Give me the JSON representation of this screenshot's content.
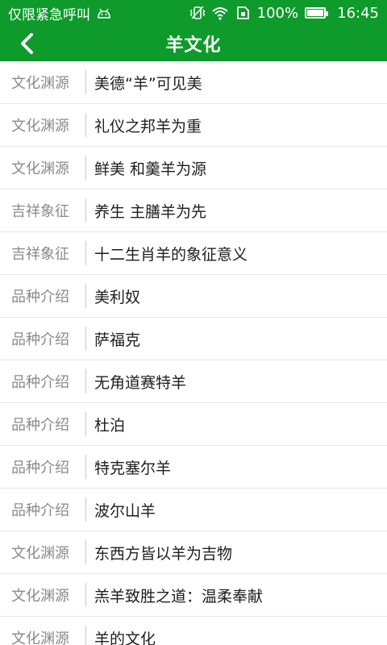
{
  "status_bar": {
    "carrier": "仅限紧急呼叫",
    "battery_percent": "100%",
    "time": "16:45",
    "icons": [
      "android-icon",
      "vibrate-icon",
      "wifi-icon",
      "sim-icon",
      "battery-icon"
    ],
    "battery_level": 1.0
  },
  "app_bar": {
    "title": "羊文化",
    "back_icon": "chevron-left-icon"
  },
  "colors": {
    "primary": "#0f9a2c",
    "category_text": "#8a8a8a",
    "title_text": "#1e1e1e",
    "divider": "#e6e6e6"
  },
  "list": {
    "items": [
      {
        "category": "文化渊源",
        "title": "美德“羊”可见美"
      },
      {
        "category": "文化渊源",
        "title": "礼仪之邦羊为重"
      },
      {
        "category": "文化渊源",
        "title": "鲜美  和羹羊为源"
      },
      {
        "category": "吉祥象征",
        "title": "养生  主膳羊为先"
      },
      {
        "category": "吉祥象征",
        "title": "十二生肖羊的象征意义"
      },
      {
        "category": "品种介绍",
        "title": "美利奴"
      },
      {
        "category": "品种介绍",
        "title": "萨福克"
      },
      {
        "category": "品种介绍",
        "title": "无角道赛特羊"
      },
      {
        "category": "品种介绍",
        "title": "杜泊"
      },
      {
        "category": "品种介绍",
        "title": "特克塞尔羊"
      },
      {
        "category": "品种介绍",
        "title": "波尔山羊"
      },
      {
        "category": "文化渊源",
        "title": "东西方皆以羊为吉物"
      },
      {
        "category": "文化渊源",
        "title": "羔羊致胜之道：温柔奉献"
      },
      {
        "category": "文化渊源",
        "title": "羊的文化"
      }
    ]
  }
}
